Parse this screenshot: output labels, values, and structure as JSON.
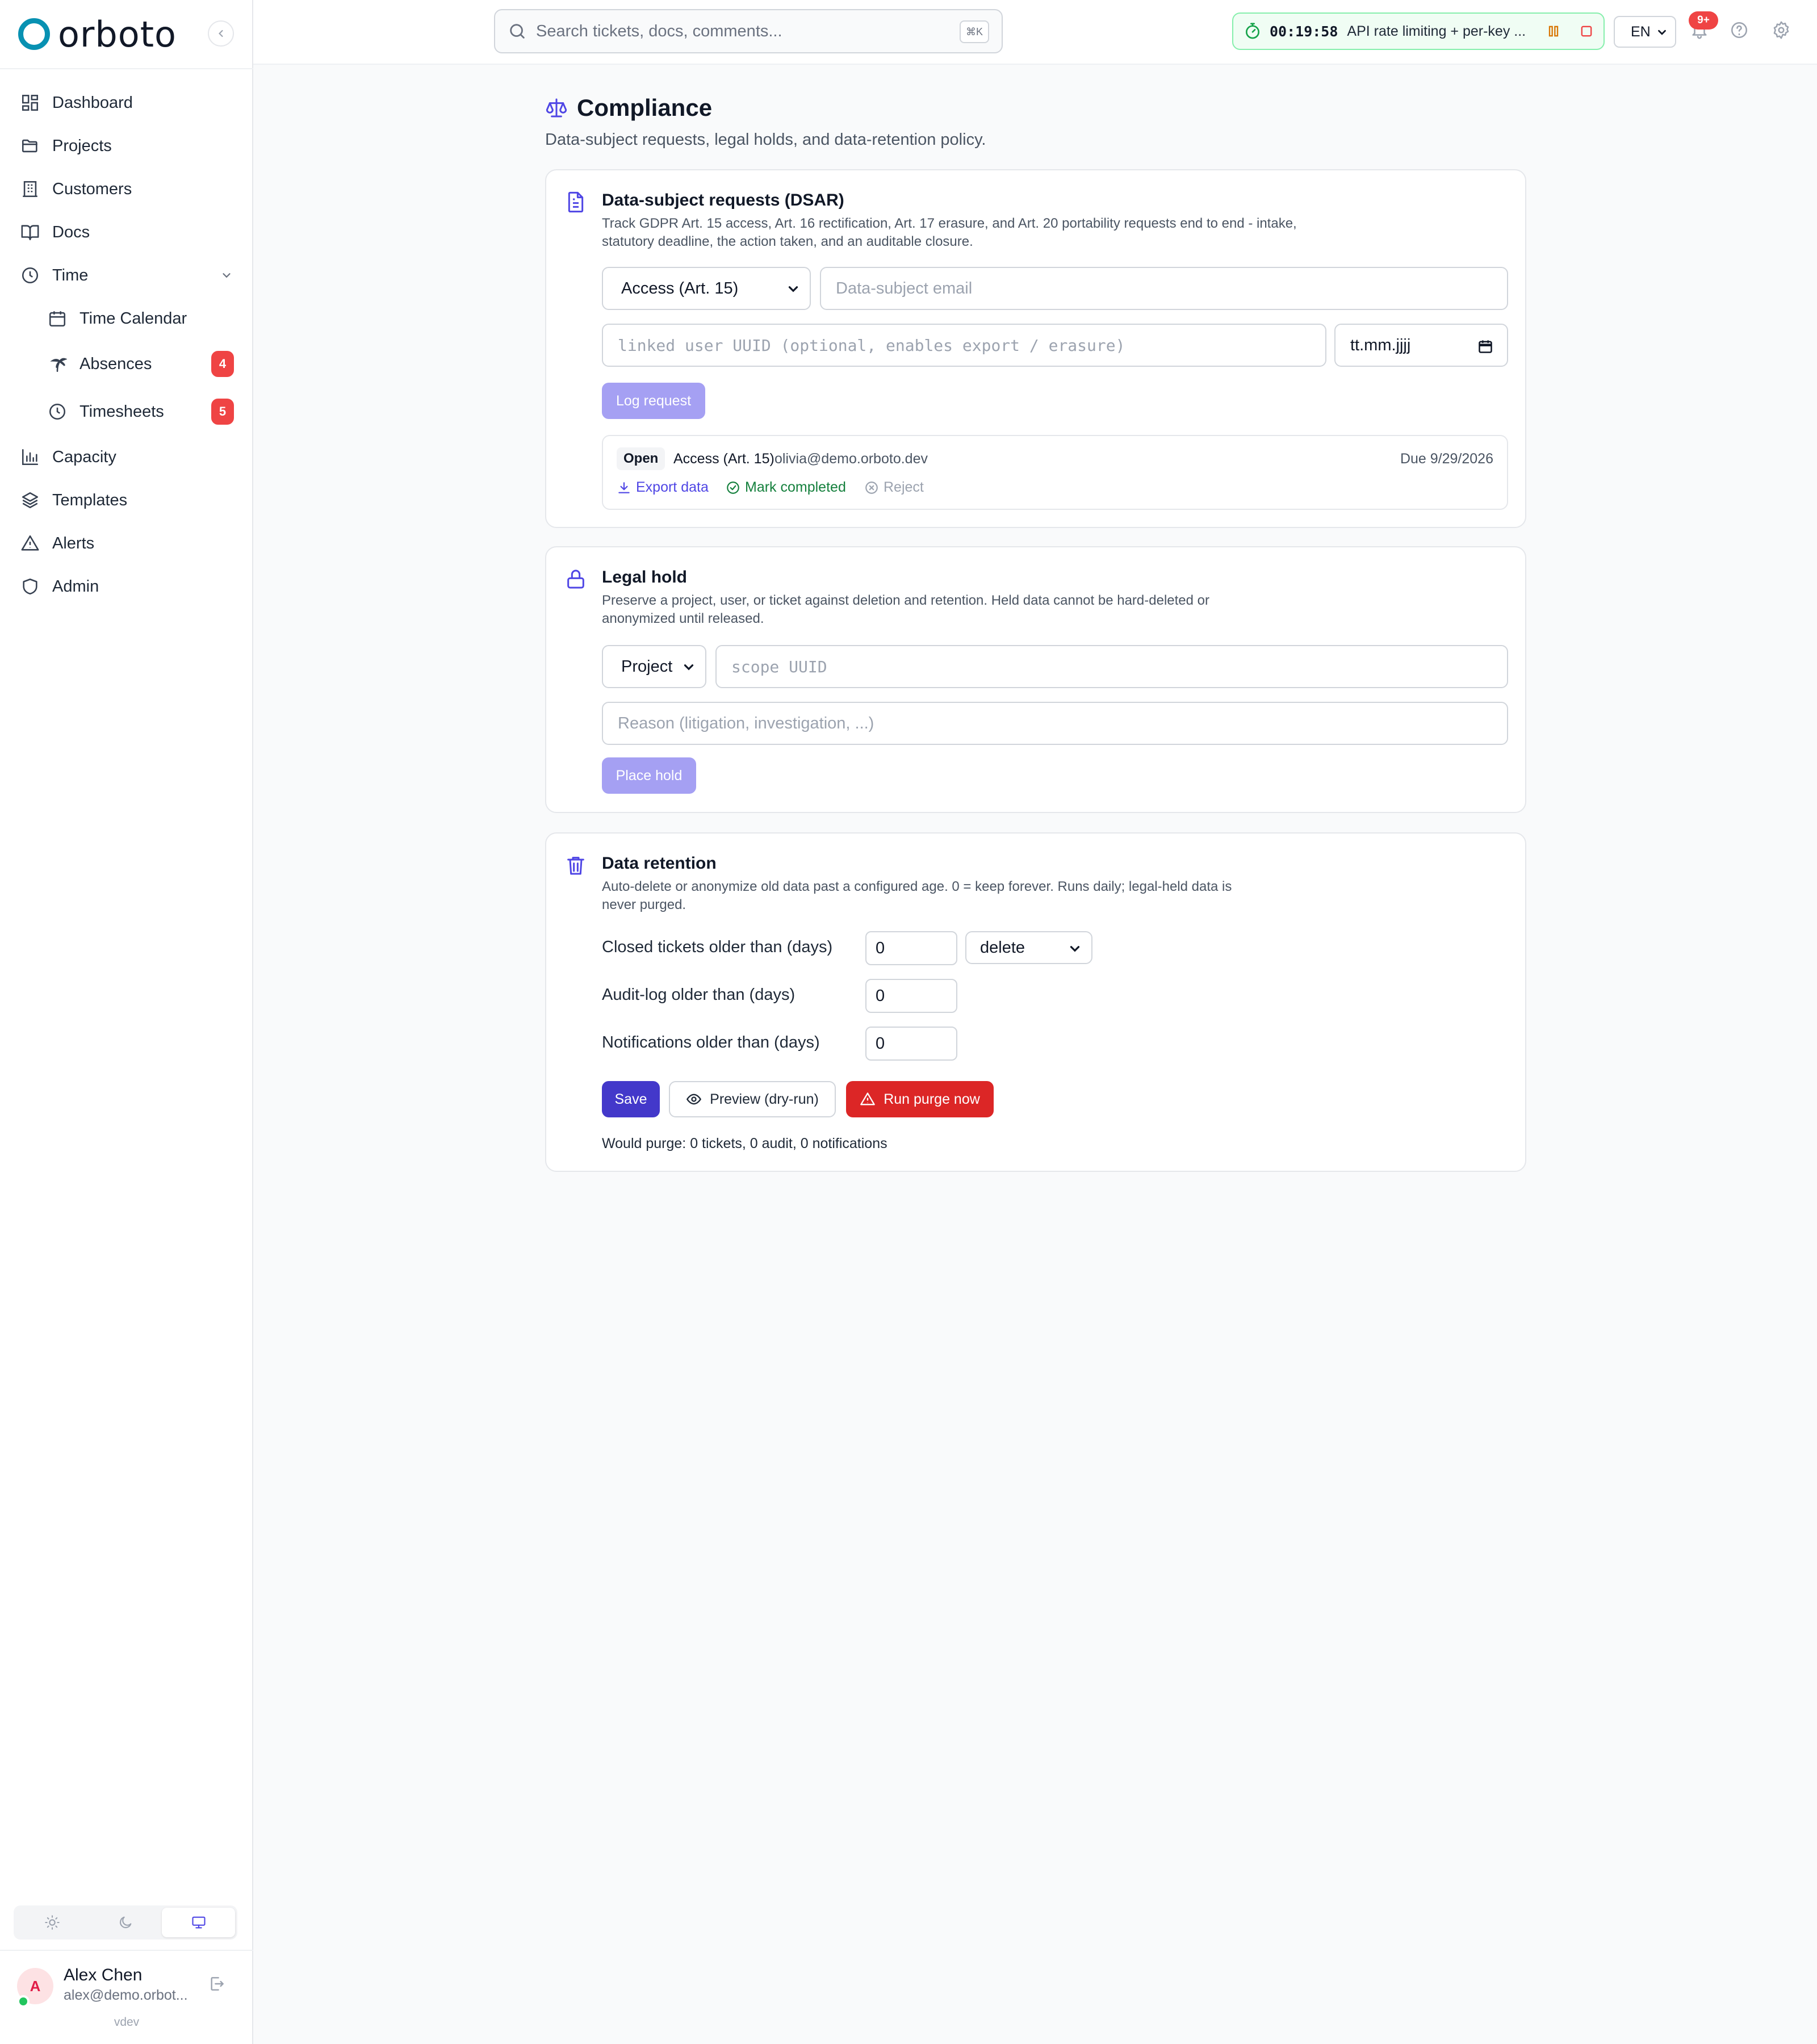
{
  "app": {
    "name": "orboto",
    "version": "vdev"
  },
  "nav": {
    "dashboard": "Dashboard",
    "projects": "Projects",
    "customers": "Customers",
    "docs": "Docs",
    "time": "Time",
    "time_calendar": "Time Calendar",
    "absences": "Absences",
    "absences_badge": "4",
    "timesheets": "Timesheets",
    "timesheets_badge": "5",
    "capacity": "Capacity",
    "templates": "Templates",
    "alerts": "Alerts",
    "admin": "Admin"
  },
  "theme": {
    "options": [
      "light",
      "dark",
      "system"
    ],
    "selected": "system"
  },
  "user": {
    "initial": "A",
    "name": "Alex Chen",
    "email": "alex@demo.orbot...",
    "status": "online"
  },
  "topbar": {
    "search_placeholder": "Search tickets, docs, comments...",
    "search_shortcut": "⌘K",
    "timer_time": "00:19:58",
    "timer_task": "API rate limiting + per-key ...",
    "language": "EN",
    "notifications_badge": "9+"
  },
  "page": {
    "title": "Compliance",
    "subtitle": "Data-subject requests, legal holds, and data-retention policy."
  },
  "dsar": {
    "title": "Data-subject requests (DSAR)",
    "description": "Track GDPR Art. 15 access, Art. 16 rectification, Art. 17 erasure, and Art. 20 portability requests end to end - intake, statutory deadline, the action taken, and an auditable closure.",
    "type_selected": "Access (Art. 15)",
    "email_placeholder": "Data-subject email",
    "uuid_placeholder": "linked user UUID (optional, enables export / erasure)",
    "date_placeholder": "tt.mm.jjjj",
    "log_button": "Log request",
    "requests": [
      {
        "status": "Open",
        "type": "Access (Art. 15)",
        "email": "olivia@demo.orboto.dev",
        "due": "Due 9/29/2026",
        "actions": {
          "export": "Export data",
          "complete": "Mark completed",
          "reject": "Reject"
        }
      }
    ]
  },
  "legal_hold": {
    "title": "Legal hold",
    "description": "Preserve a project, user, or ticket against deletion and retention. Held data cannot be hard-deleted or anonymized until released.",
    "scope_selected": "Project",
    "uuid_placeholder": "scope UUID",
    "reason_placeholder": "Reason (litigation, investigation, ...)",
    "button": "Place hold"
  },
  "retention": {
    "title": "Data retention",
    "description": "Auto-delete or anonymize old data past a configured age. 0 = keep forever. Runs daily; legal-held data is never purged.",
    "rows": [
      {
        "label": "Closed tickets older than (days)",
        "value": "0",
        "mode": "delete"
      },
      {
        "label": "Audit-log older than (days)",
        "value": "0"
      },
      {
        "label": "Notifications older than (days)",
        "value": "0"
      }
    ],
    "save": "Save",
    "preview": "Preview (dry-run)",
    "purge": "Run purge now",
    "preview_result": "Would purge: 0 tickets, 0 audit, 0 notifications"
  },
  "colors": {
    "brand": "#0891b2",
    "accent": "#4f46e5",
    "danger": "#dc2626",
    "success": "#16a34a",
    "badge": "#ef4444"
  }
}
